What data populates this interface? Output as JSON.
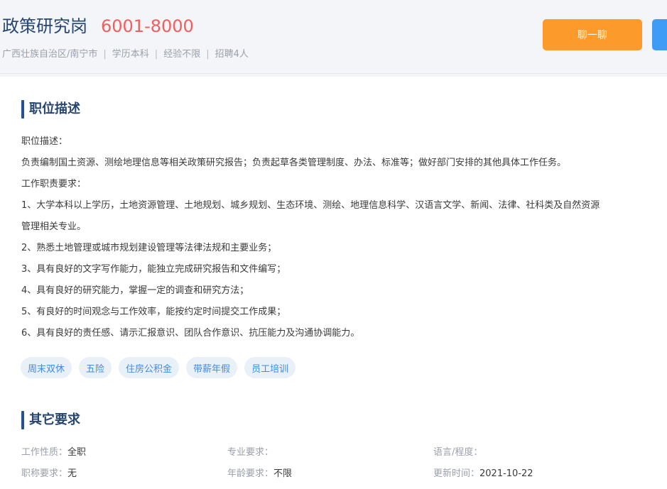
{
  "job": {
    "title": "政策研究岗",
    "salary": "6001-8000",
    "location": "广西壮族自治区/南宁市",
    "education": "学历本科",
    "experience": "经验不限",
    "headcount": "招聘4人",
    "separator": "|"
  },
  "actions": {
    "chat_label": "聊一聊"
  },
  "description": {
    "section_title": "职位描述",
    "lines": [
      "职位描述：",
      "负责编制国土资源、测绘地理信息等相关政策研究报告；负责起草各类管理制度、办法、标准等；做好部门安排的其他具体工作任务。",
      "工作职责要求：",
      "1、大学本科以上学历，土地资源管理、土地规划、城乡规划、生态环境、测绘、地理信息科学、汉语言文学、新闻、法律、社科类及自然资源",
      "管理相关专业。",
      "2、熟悉土地管理或城市规划建设管理等法律法规和主要业务；",
      "3、具有良好的文字写作能力，能独立完成研究报告和文件编写；",
      "4、具有良好的研究能力，掌握一定的调查和研究方法；",
      "5、有良好的时间观念与工作效率，能按约定时间提交工作成果；",
      "6、具有良好的责任感、请示汇报意识、团队合作意识、抗压能力及沟通协调能力。"
    ]
  },
  "benefits": [
    "周末双休",
    "五险",
    "住房公积金",
    "带薪年假",
    "员工培训"
  ],
  "other_requirements": {
    "section_title": "其它要求",
    "rows": [
      [
        {
          "label": "工作性质：",
          "value": "全职"
        },
        {
          "label": "专业要求：",
          "value": ""
        },
        {
          "label": "语言/程度：",
          "value": ""
        }
      ],
      [
        {
          "label": "职称要求：",
          "value": "无"
        },
        {
          "label": "年龄要求：",
          "value": "不限"
        },
        {
          "label": "更新时间：",
          "value": "2021-10-22"
        }
      ]
    ]
  },
  "colors": {
    "title": "#25456f",
    "salary": "#f25d5d",
    "chat_button": "#fc9b2b",
    "apply_button": "#3e9bf6",
    "tag_bg": "#e9f0f8",
    "tag_text": "#3f8ce8"
  }
}
